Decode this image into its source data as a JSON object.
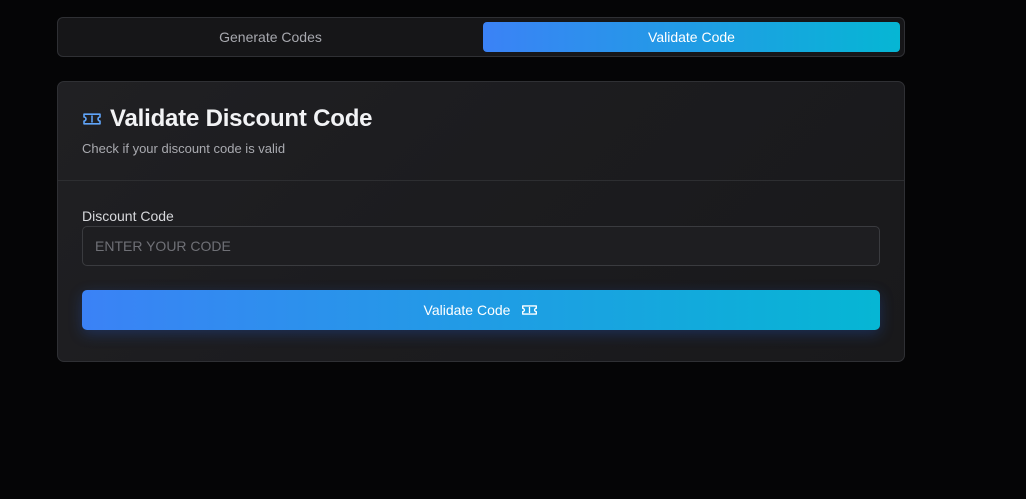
{
  "tabs": {
    "items": [
      {
        "label": "Generate Codes"
      },
      {
        "label": "Validate Code"
      }
    ],
    "active_index": 1
  },
  "card": {
    "icon": "ticket-icon",
    "title": "Validate Discount Code",
    "subtitle": "Check if your discount code is valid"
  },
  "form": {
    "label": "Discount Code",
    "value": "",
    "placeholder": "ENTER YOUR CODE"
  },
  "button": {
    "label": "Validate Code",
    "icon": "ticket-icon"
  },
  "colors": {
    "background": "#050506",
    "accent_start": "#3b82f6",
    "accent_end": "#06b6d4",
    "card": "#1e1e21"
  }
}
